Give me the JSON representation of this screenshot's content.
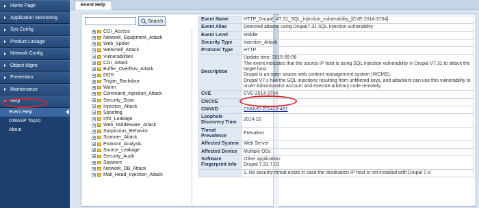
{
  "sidebar": {
    "items": [
      {
        "label": "Home Page"
      },
      {
        "label": "Application Monitoring"
      },
      {
        "label": "Sys Config"
      },
      {
        "label": "Product Linkage"
      },
      {
        "label": "Network Config"
      },
      {
        "label": "Object Mgmt"
      },
      {
        "label": "Prevention"
      },
      {
        "label": "Maintenance"
      },
      {
        "label": "Help"
      }
    ],
    "sub_items": [
      {
        "label": "Event Help"
      },
      {
        "label": "OWASP Top10"
      },
      {
        "label": "About"
      }
    ]
  },
  "tab": {
    "label": "Event Help"
  },
  "search": {
    "button_label": "Search",
    "value": ""
  },
  "tree": [
    "CGI_Access",
    "Network_Equipment_Attack",
    "Web_Spider",
    "Webshell_Attack",
    "Vulnerabilities",
    "CGI_Attack",
    "Buffer_Overflow_Attack",
    "DOS",
    "Trojan_Backdoor",
    "Worm",
    "Command_Injection_Attack",
    "Security_Scan",
    "Injection_Attack",
    "Spoofing",
    "Info_Leakage",
    "Web_Middleware_Attack",
    "Suspicious_Behavior",
    "Scanner_Attack",
    "Protocol_Analysis",
    "Source_Leakage",
    "Security_Audit",
    "Spyware",
    "Network_DB_Attack",
    "Mail_Head_Injection_Attack"
  ],
  "details": {
    "event_name_label": "Event Name",
    "event_name": "HTTP_Drupal_V7.31_SQL_injection_vulnerability_[CVE-2014-3704]",
    "event_alias_label": "Event Alias",
    "event_alias": "Detected attacks using Drupal7.31 SQL injection vulnerability",
    "event_level_label": "Event Level",
    "event_level": "Middle",
    "security_type_label": "Security Type",
    "security_type": "Injection_Attack",
    "protocol_type_label": "Protocol Type",
    "protocol_type": "HTTP",
    "description_label": "Description",
    "description_lines": [
      "Update time: 2015-09-06",
      "The event indicates that the source IP host is using SQL injection vulnerability in Drupal V7.31 to attack the target host.",
      "Drupal is an open source web content management system (WCMS).",
      "Drupal V7.x has the SQL injections resulting from unfiltered keys, and attackers can use this vulnerability to insert Administrator account and execute arbitrary code remotely."
    ],
    "cve_label": "CVE",
    "cve": "CVE-2014-3704",
    "cncve_label": "CNCVE",
    "cncve": "",
    "cnnvd_label": "CNNVD",
    "cnnvd": "CNNVD-201410-462",
    "loophole_label": "Loophole Discovery Time",
    "loophole": "2014-10",
    "threat_label": "Threat Prevalence",
    "threat": "Prevalent",
    "affected_system_label": "Affected System",
    "affected_system": "Web Server",
    "affected_device_label": "Affected Device",
    "affected_device": "Multiple OSs",
    "fingerprint_label": "Software Fingerprint Info",
    "fingerprint_lines": [
      "Other application:",
      "Drupal 7.31-7.01"
    ],
    "last_line": "1. No security threat exists in case the destination IP host is not installed with Drupal 7.x;"
  },
  "colors": {
    "sidebar": "#1c3f6e",
    "highlight_oval": "#d8252a",
    "label_bg": "#e1e9f3"
  }
}
